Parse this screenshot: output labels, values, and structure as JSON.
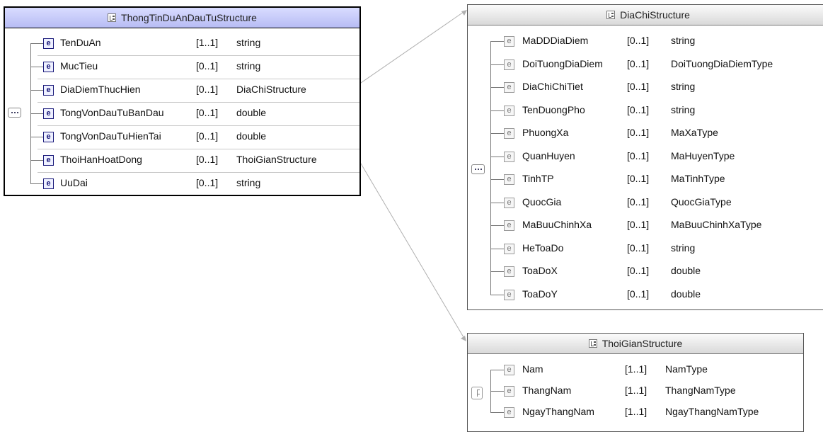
{
  "main": {
    "title": "ThongTinDuAnDauTuStructure",
    "rows": [
      {
        "icon": "e",
        "name": "TenDuAn",
        "mult": "[1..1]",
        "type": "string"
      },
      {
        "icon": "e",
        "name": "MucTieu",
        "mult": "[0..1]",
        "type": "string"
      },
      {
        "icon": "e",
        "name": "DiaDiemThucHien",
        "mult": "[0..1]",
        "type": "DiaChiStructure"
      },
      {
        "icon": "e",
        "name": "TongVonDauTuBanDau",
        "mult": "[0..1]",
        "type": "double"
      },
      {
        "icon": "e",
        "name": "TongVonDauTuHienTai",
        "mult": "[0..1]",
        "type": "double"
      },
      {
        "icon": "e",
        "name": "ThoiHanHoatDong",
        "mult": "[0..1]",
        "type": "ThoiGianStructure"
      },
      {
        "icon": "e",
        "name": "UuDai",
        "mult": "[0..1]",
        "type": "string"
      }
    ]
  },
  "diachi": {
    "title": "DiaChiStructure",
    "rows": [
      {
        "icon": "e",
        "name": "MaDDDiaDiem",
        "mult": "[0..1]",
        "type": "string"
      },
      {
        "icon": "e",
        "name": "DoiTuongDiaDiem",
        "mult": "[0..1]",
        "type": "DoiTuongDiaDiemType"
      },
      {
        "icon": "e",
        "name": "DiaChiChiTiet",
        "mult": "[0..1]",
        "type": "string"
      },
      {
        "icon": "e",
        "name": "TenDuongPho",
        "mult": "[0..1]",
        "type": "string"
      },
      {
        "icon": "e",
        "name": "PhuongXa",
        "mult": "[0..1]",
        "type": "MaXaType"
      },
      {
        "icon": "e",
        "name": "QuanHuyen",
        "mult": "[0..1]",
        "type": "MaHuyenType"
      },
      {
        "icon": "e",
        "name": "TinhTP",
        "mult": "[0..1]",
        "type": "MaTinhType"
      },
      {
        "icon": "e",
        "name": "QuocGia",
        "mult": "[0..1]",
        "type": "QuocGiaType"
      },
      {
        "icon": "e",
        "name": "MaBuuChinhXa",
        "mult": "[0..1]",
        "type": "MaBuuChinhXaType"
      },
      {
        "icon": "e",
        "name": "HeToaDo",
        "mult": "[0..1]",
        "type": "string"
      },
      {
        "icon": "e",
        "name": "ToaDoX",
        "mult": "[0..1]",
        "type": "double"
      },
      {
        "icon": "e",
        "name": "ToaDoY",
        "mult": "[0..1]",
        "type": "double"
      }
    ]
  },
  "thoigian": {
    "title": "ThoiGianStructure",
    "rows": [
      {
        "icon": "e",
        "name": "Nam",
        "mult": "[1..1]",
        "type": "NamType"
      },
      {
        "icon": "e",
        "name": "ThangNam",
        "mult": "[1..1]",
        "type": "ThangNamType"
      },
      {
        "icon": "e",
        "name": "NgayThangNam",
        "mult": "[1..1]",
        "type": "NgayThangNamType"
      }
    ]
  }
}
